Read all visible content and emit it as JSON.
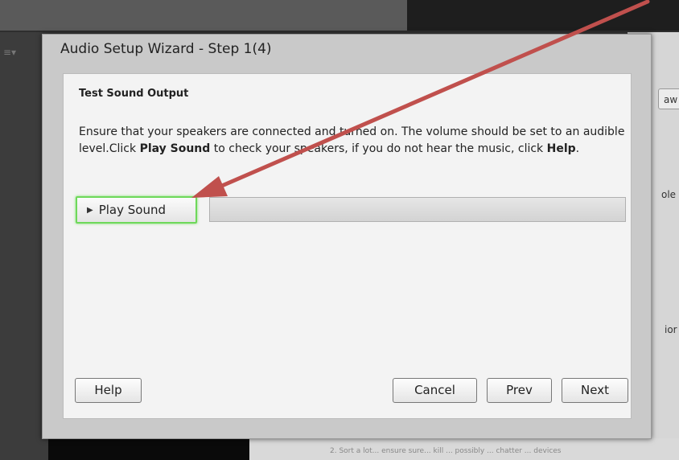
{
  "background": {
    "menu_icon": "≡▾",
    "right_button_label": "aw",
    "right_text_1": "ole",
    "right_text_2": "ior",
    "bottom_text": "2.  Sort a lot... ensure sure... kill ... possibly ... chatter ... devices"
  },
  "dialog": {
    "title": "Audio Setup Wizard - Step 1(4)",
    "section_title": "Test Sound Output",
    "instructions": {
      "part1": "Ensure that your speakers are connected and turned on. The volume should be set to an audible level.Click ",
      "bold1": "Play Sound",
      "part2": " to check your speakers, if you do not hear the music, click ",
      "bold2": "Help",
      "part3": "."
    },
    "play_button_label": "Play Sound",
    "play_icon": "play-icon",
    "progress_value": 0,
    "buttons": {
      "help": "Help",
      "cancel": "Cancel",
      "prev": "Prev",
      "next": "Next"
    }
  },
  "colors": {
    "highlight_green": "#6ed85a",
    "annotation_arrow": "#c0504d"
  }
}
